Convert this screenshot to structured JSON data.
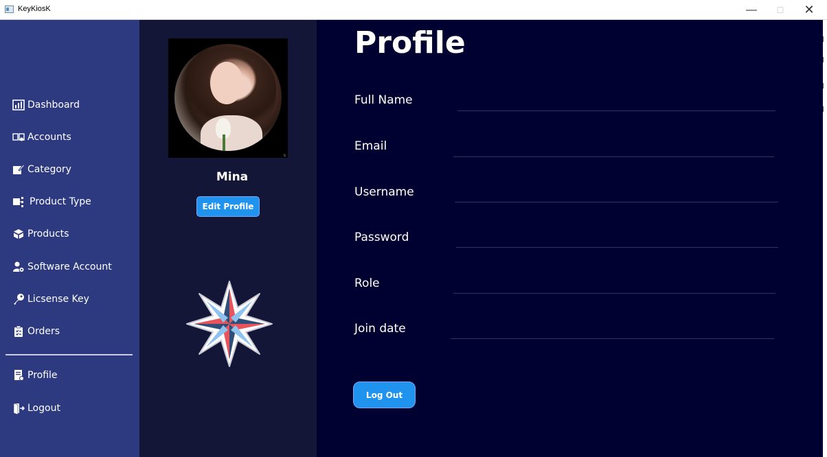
{
  "window": {
    "title": "KeyKiosK",
    "minimize_glyph": "—",
    "maximize_glyph": "☐",
    "close_glyph": "✕"
  },
  "sidebar": {
    "items": [
      {
        "label": "Dashboard",
        "icon": "dashboard-icon"
      },
      {
        "label": "Accounts",
        "icon": "accounts-icon"
      },
      {
        "label": "Category",
        "icon": "category-icon"
      },
      {
        "label": "Product Type",
        "icon": "product-type-icon"
      },
      {
        "label": "Products",
        "icon": "products-icon"
      },
      {
        "label": "Software Account",
        "icon": "software-account-icon"
      },
      {
        "label": "Licsense Key",
        "icon": "key-icon"
      },
      {
        "label": "Orders",
        "icon": "orders-icon"
      },
      {
        "label": "Profile",
        "icon": "profile-icon"
      },
      {
        "label": "Logout",
        "icon": "logout-icon"
      }
    ]
  },
  "profile_panel": {
    "name": "Mina",
    "edit_button": "Edit Profile"
  },
  "main": {
    "title": "Profile",
    "fields": [
      {
        "label": "Full Name",
        "value": ""
      },
      {
        "label": "Email",
        "value": ""
      },
      {
        "label": "Username",
        "value": ""
      },
      {
        "label": "Password",
        "value": ""
      },
      {
        "label": "Role",
        "value": ""
      },
      {
        "label": "Join date",
        "value": ""
      }
    ],
    "logout_button": "Log Out"
  },
  "colors": {
    "sidebar_bg": "#2e3a80",
    "panel_bg": "#141638",
    "main_bg": "#010131",
    "accent_button": "#1f93ee",
    "text": "#ffffff"
  }
}
